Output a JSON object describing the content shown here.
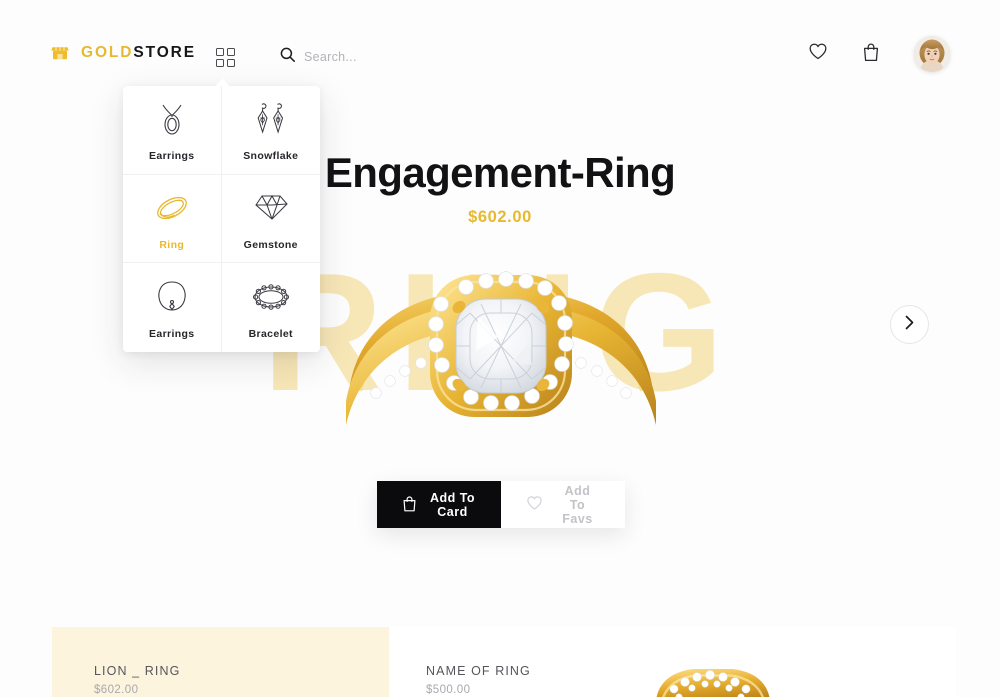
{
  "header": {
    "logo_icon": "shop-awning-icon",
    "brand_primary": "GOLD",
    "brand_secondary": "STORE",
    "grid_icon": "grid-apps-icon",
    "search": {
      "icon": "search-icon",
      "value": "",
      "placeholder": "Search..."
    },
    "actions": [
      {
        "icon": "heart-icon",
        "name": "wishlist"
      },
      {
        "icon": "shopping-bag-icon",
        "name": "cart"
      },
      {
        "icon": "avatar",
        "name": "user-profile"
      }
    ]
  },
  "dropdown": {
    "items": [
      {
        "label": "Earrings",
        "icon": "necklace-teardrop-icon",
        "active": false
      },
      {
        "label": "Snowflake",
        "icon": "snowflake-earrings-icon",
        "active": false
      },
      {
        "label": "Ring",
        "icon": "ring-band-icon",
        "active": true
      },
      {
        "label": "Gemstone",
        "icon": "gemstone-icon",
        "active": false
      },
      {
        "label": "Earrings",
        "icon": "pendant-necklace-icon",
        "active": false
      },
      {
        "label": "Bracelet",
        "icon": "bracelet-icon",
        "active": false
      }
    ]
  },
  "product": {
    "title": "Engagement-Ring",
    "price": "$602.00",
    "watermark": "RING",
    "image_alt": "gold-diamond-engagement-ring",
    "next_icon": "chevron-right-icon"
  },
  "cta": {
    "primary_label": "Add To Card",
    "primary_icon": "shopping-bag-icon",
    "secondary_label": "Add To Favs",
    "secondary_icon": "heart-icon"
  },
  "related": {
    "cards": [
      {
        "name": "LION _ RING",
        "price": "$602.00"
      },
      {
        "name": "NAME OF RING",
        "price": "$500.00"
      }
    ]
  },
  "colors": {
    "gold": "#e8b92e",
    "watermark_gold": "#f7e6b6",
    "cream_card": "#fdf4de",
    "dark": "#0b0b0d",
    "page_bg": "#fdfdfd"
  }
}
